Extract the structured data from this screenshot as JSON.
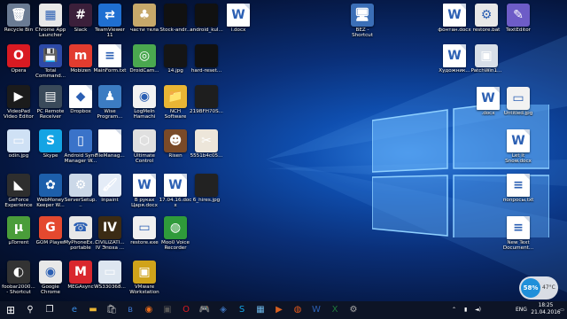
{
  "desktop": {
    "icons": [
      {
        "label": "Recycle Bin",
        "glyph": "🗑",
        "bg": "#6a7b93"
      },
      {
        "label": "Chrome App Launcher",
        "glyph": "▦",
        "bg": "#e9e9e9"
      },
      {
        "label": "Slack",
        "glyph": "#",
        "bg": "#3b1f3a"
      },
      {
        "label": "TeamViewer 11",
        "glyph": "⇄",
        "bg": "#1f6fd1"
      },
      {
        "label": "части тела",
        "glyph": "♣",
        "bg": "#c7a86a"
      },
      {
        "label": "Stock-andr...",
        "glyph": "",
        "bg": "#111"
      },
      {
        "label": "android_kul...",
        "glyph": "",
        "bg": "#111"
      },
      {
        "label": "l.docx",
        "glyph": "W",
        "bg": "#fff"
      },
      {
        "label": "BEZ - Shortcut",
        "glyph": "🖥",
        "bg": "#3b6fb7"
      },
      {
        "label": "фонтан.docx",
        "glyph": "W",
        "bg": "#fff"
      },
      {
        "label": "restore.bat",
        "glyph": "⚙",
        "bg": "#e8e8e8"
      },
      {
        "label": "TextEditor",
        "glyph": "✎",
        "bg": "#6d5cc7"
      },
      {
        "label": "Opera",
        "glyph": "O",
        "bg": "#d91a22"
      },
      {
        "label": "Total Command...",
        "glyph": "💾",
        "bg": "#2d4aa8"
      },
      {
        "label": "Mobizen",
        "glyph": "m",
        "bg": "#e23c2f"
      },
      {
        "label": "MainForm.txt",
        "glyph": "≡",
        "bg": "#fff"
      },
      {
        "label": "DroidCam...",
        "glyph": "◎",
        "bg": "#4aa84f"
      },
      {
        "label": "14.jpg",
        "glyph": "",
        "bg": "#151515"
      },
      {
        "label": "hard-reset...",
        "glyph": "",
        "bg": "#111"
      },
      {
        "label": "Художник...",
        "glyph": "W",
        "bg": "#fff"
      },
      {
        "label": "PatchWin1...",
        "glyph": "▣",
        "bg": "#d8dfe8"
      },
      {
        "label": ".docx",
        "glyph": "W",
        "bg": "#fff"
      },
      {
        "label": "Untitled.jpg",
        "glyph": "▭",
        "bg": "#f2f2f2"
      },
      {
        "label": "VideoPad Video Editor",
        "glyph": "▶",
        "bg": "#1b1b1b"
      },
      {
        "label": "PC Remote Receiver",
        "glyph": "▤",
        "bg": "#3a4a5a"
      },
      {
        "label": "Dropbox",
        "glyph": "◆",
        "bg": "#fff"
      },
      {
        "label": "Wise Program...",
        "glyph": "♟",
        "bg": "#3c7cc2"
      },
      {
        "label": "LogMeIn Hamachi",
        "glyph": "◉",
        "bg": "#f2f2f2"
      },
      {
        "label": "NCH Software",
        "glyph": "📁",
        "bg": "#e9b534"
      },
      {
        "label": "219BFH70S...",
        "glyph": "",
        "bg": "#1e1e1e"
      },
      {
        "label": "Let It Snow.docx",
        "glyph": "W",
        "bg": "#fff"
      },
      {
        "label": "odin.jpg",
        "glyph": "▭",
        "bg": "#cfe1f5"
      },
      {
        "label": "Skype",
        "glyph": "S",
        "bg": "#14a4e4"
      },
      {
        "label": "Android Sync Manager W...",
        "glyph": "▯",
        "bg": "#3a73c9"
      },
      {
        "label": "FileManag...",
        "glyph": "",
        "bg": "#fff"
      },
      {
        "label": "Ultimate Control",
        "glyph": "⬡",
        "bg": "#e0e0e0"
      },
      {
        "label": "Risen",
        "glyph": "☻",
        "bg": "#7a4a28"
      },
      {
        "label": "5551b4c05...",
        "glyph": "✂",
        "bg": "#ede6da"
      },
      {
        "label": "GeForce Experience",
        "glyph": "◣",
        "bg": "#2e2e2e"
      },
      {
        "label": "WebMoney Keeper W...",
        "glyph": "✿",
        "bg": "#1d5fab"
      },
      {
        "label": "ServerSetup...",
        "glyph": "⚙",
        "bg": "#cbd8e8"
      },
      {
        "label": "Inpaint",
        "glyph": "🖌",
        "bg": "#e4ecf7"
      },
      {
        "label": "В руках Царя.docx",
        "glyph": "W",
        "bg": "#fff"
      },
      {
        "label": "17.04.16.docx",
        "glyph": "W",
        "bg": "#fff"
      },
      {
        "label": "6_hires.jpg",
        "glyph": "",
        "bg": "#222"
      },
      {
        "label": "попросы.txt",
        "glyph": "≡",
        "bg": "#fff"
      },
      {
        "label": "µTorrent",
        "glyph": "µ",
        "bg": "#4a9d3a"
      },
      {
        "label": "GOM Player",
        "glyph": "G",
        "bg": "#e4492f"
      },
      {
        "label": "MyPhoneEx... portable",
        "glyph": "☎",
        "bg": "#e8e8e8"
      },
      {
        "label": "CIVILIZATI... IV Эпоха ...",
        "glyph": "IV",
        "bg": "#3b2b14"
      },
      {
        "label": "restore.exe",
        "glyph": "▭",
        "bg": "#f0f0f0"
      },
      {
        "label": "Moo0 Voice Recorder 1.43",
        "glyph": "◍",
        "bg": "#2f9b3a"
      },
      {
        "label": "New Text Document...",
        "glyph": "≡",
        "bg": "#fff"
      },
      {
        "label": "foobar2000... - Shortcut",
        "glyph": "◐",
        "bg": "#333"
      },
      {
        "label": "Google Chrome",
        "glyph": "◉",
        "bg": "#e8e8e8"
      },
      {
        "label": "MEGAsync",
        "glyph": "M",
        "bg": "#d9272e"
      },
      {
        "label": "WS330368...",
        "glyph": "▭",
        "bg": "#dde6f0"
      },
      {
        "label": "VMware Workstation",
        "glyph": "▣",
        "bg": "#d0a31a"
      }
    ]
  },
  "taskbar": {
    "start_icon": "⊞",
    "search_icon": "⚲",
    "taskview_icon": "❐",
    "pinned": [
      {
        "name": "edge",
        "glyph": "e",
        "color": "#3a8ee6"
      },
      {
        "name": "explorer",
        "glyph": "▬",
        "color": "#e9b534"
      },
      {
        "name": "store",
        "glyph": "🛍",
        "color": "#bbb"
      },
      {
        "name": "bluetooth-app",
        "glyph": "ʙ",
        "color": "#3a73c9"
      },
      {
        "name": "firefox",
        "glyph": "◉",
        "color": "#e66a1a"
      },
      {
        "name": "app-dark",
        "glyph": "▣",
        "color": "#555"
      },
      {
        "name": "opera",
        "glyph": "O",
        "color": "#d91a22"
      },
      {
        "name": "gamepad",
        "glyph": "🎮",
        "color": "#ddd"
      },
      {
        "name": "app-blue",
        "glyph": "◈",
        "color": "#3b6fb7"
      },
      {
        "name": "skype",
        "glyph": "S",
        "color": "#14a4e4"
      },
      {
        "name": "photos",
        "glyph": "▦",
        "color": "#6cb6e6"
      },
      {
        "name": "media",
        "glyph": "▶",
        "color": "#d86020"
      },
      {
        "name": "app-orange",
        "glyph": "◍",
        "color": "#e45a1c"
      },
      {
        "name": "word",
        "glyph": "W",
        "color": "#2b5fb3"
      },
      {
        "name": "excel",
        "glyph": "X",
        "color": "#1e7a3c"
      },
      {
        "name": "app-settings",
        "glyph": "⚙",
        "color": "#aaa"
      }
    ],
    "lang": "ENG",
    "time": "18:25",
    "date": "21.04.2016",
    "tray_up": "⌃",
    "notif_icon": "▭"
  },
  "widget": {
    "percent": "58%",
    "temp": "47°C"
  }
}
